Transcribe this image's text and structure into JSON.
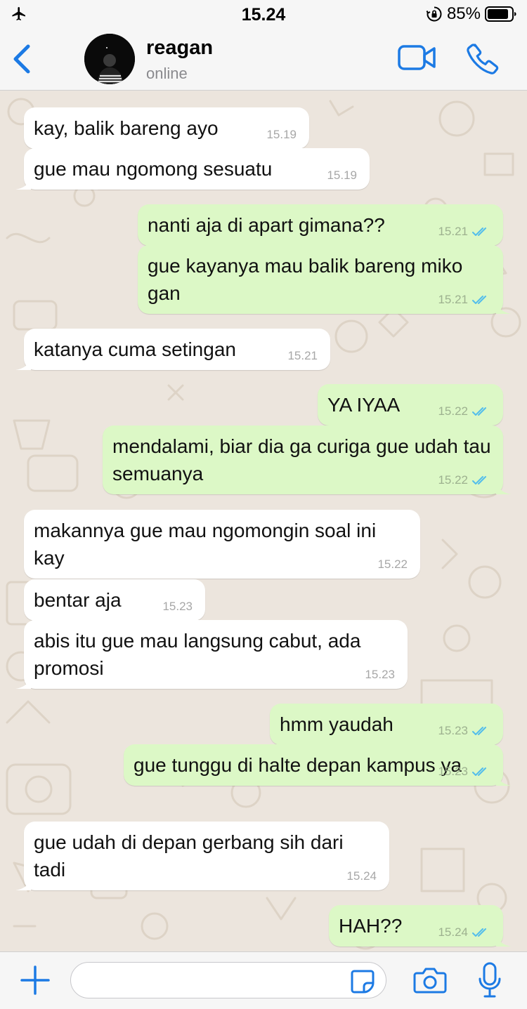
{
  "status_bar": {
    "time": "15.24",
    "battery_percent": "85%",
    "icons": [
      "airplane-icon",
      "orientation-lock-icon",
      "battery-icon"
    ]
  },
  "header": {
    "contact_name": "reagan",
    "contact_status": "online",
    "icons": [
      "back-chevron-icon",
      "video-call-icon",
      "phone-icon"
    ]
  },
  "messages": [
    {
      "dir": "in",
      "text": "kay, balik bareng ayo",
      "time": "15.19",
      "tail": false
    },
    {
      "dir": "in",
      "text": "gue mau ngomong sesuatu",
      "time": "15.19",
      "tail": true
    },
    {
      "dir": "out",
      "text": "nanti aja di apart gimana??",
      "time": "15.21",
      "read": true,
      "tail": false
    },
    {
      "dir": "out",
      "text": "gue kayanya mau balik bareng miko gan",
      "time": "15.21",
      "read": true,
      "tail": true
    },
    {
      "dir": "in",
      "text": "katanya cuma setingan",
      "time": "15.21",
      "tail": true
    },
    {
      "dir": "out",
      "text": "YA IYAA",
      "time": "15.22",
      "read": true,
      "tail": false
    },
    {
      "dir": "out",
      "text": "mendalami, biar dia ga curiga gue udah tau semuanya",
      "time": "15.22",
      "read": true,
      "tail": true
    },
    {
      "dir": "in",
      "text": "makannya gue mau ngomongin soal ini kay",
      "time": "15.22",
      "tail": false
    },
    {
      "dir": "in",
      "text": "bentar aja",
      "time": "15.23",
      "tail": false
    },
    {
      "dir": "in",
      "text": "abis itu gue mau langsung cabut, ada promosi",
      "time": "15.23",
      "tail": true
    },
    {
      "dir": "out",
      "text": "hmm yaudah",
      "time": "15.23",
      "read": true,
      "tail": false
    },
    {
      "dir": "out",
      "text": "gue tunggu di halte depan kampus ya",
      "time": "15.23",
      "read": true,
      "tail": true
    },
    {
      "dir": "in",
      "text": "gue udah di depan gerbang sih dari tadi",
      "time": "15.24",
      "tail": true
    },
    {
      "dir": "out",
      "text": "HAH??",
      "time": "15.24",
      "read": true,
      "tail": true
    }
  ],
  "input_bar": {
    "placeholder": "",
    "value": "",
    "icons": [
      "plus-icon",
      "sticker-icon",
      "camera-icon",
      "microphone-icon"
    ]
  },
  "colors": {
    "accent": "#1C7AE4",
    "outgoing_bubble": "#DCF8C6",
    "incoming_bubble": "#FFFFFF",
    "chat_background": "#ECE5DD",
    "read_ticks": "#53BDEB"
  }
}
